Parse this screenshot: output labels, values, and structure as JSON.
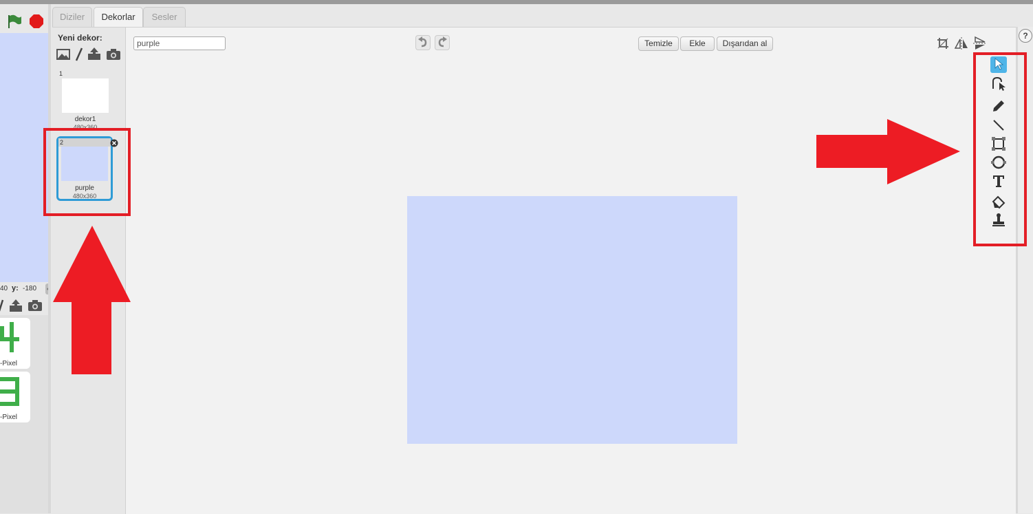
{
  "tabs": [
    {
      "label": "Diziler"
    },
    {
      "label": "Dekorlar"
    },
    {
      "label": "Sesler"
    }
  ],
  "costume_panel": {
    "new_label": "Yeni dekor:",
    "tools": [
      "image-icon",
      "paintbrush-icon",
      "upload-icon",
      "camera-icon"
    ],
    "costumes": [
      {
        "number": "1",
        "name": "dekor1",
        "size": "480x360"
      },
      {
        "number": "2",
        "name": "purple",
        "size": "480x360"
      }
    ]
  },
  "editor": {
    "name_value": "purple",
    "buttons": {
      "clear": "Temizle",
      "add": "Ekle",
      "import": "Dışarıdan al"
    },
    "tools": [
      "select-icon",
      "reshape-icon",
      "pencil-icon",
      "line-icon",
      "rectangle-icon",
      "ellipse-icon",
      "text-icon",
      "fill-icon",
      "stamp-icon"
    ]
  },
  "stage_info": {
    "x_partial": "40",
    "y_label": "y:",
    "y_value": "-180"
  },
  "sprites": [
    {
      "label": "-Pixel"
    },
    {
      "label": "-Pixel"
    }
  ],
  "help": {
    "label": "?"
  },
  "colors": {
    "backdrop": "#cdd8fb",
    "highlight": "#e31e26",
    "selected_tool": "#4fb5e8",
    "selected_costume": "#2e9bd6",
    "sprite_green": "#3fae49"
  }
}
